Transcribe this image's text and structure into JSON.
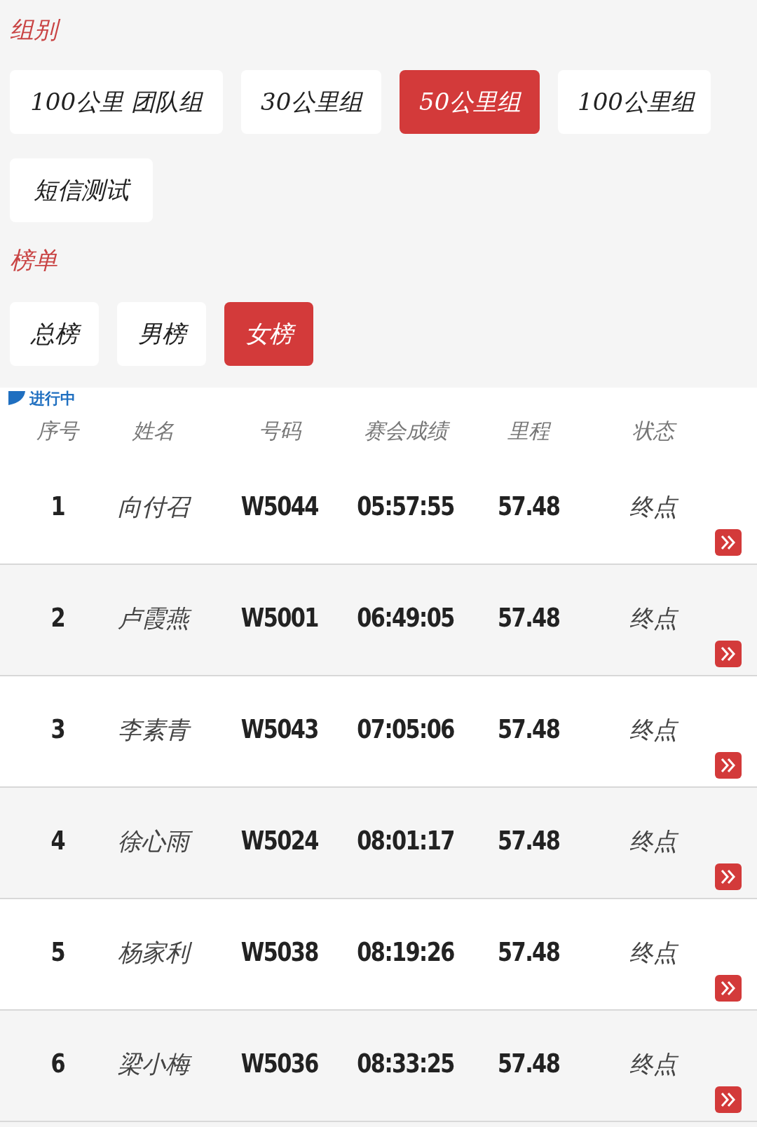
{
  "group_section": {
    "title": "组别",
    "options": [
      {
        "label": "100公里 团队组",
        "selected": false
      },
      {
        "label": "30公里组",
        "selected": false
      },
      {
        "label": "50公里组",
        "selected": true
      },
      {
        "label": "100公里组",
        "selected": false
      },
      {
        "label": "短信测试",
        "selected": false
      }
    ]
  },
  "ranking_section": {
    "title": "榜单",
    "tabs": [
      {
        "label": "总榜",
        "selected": false
      },
      {
        "label": "男榜",
        "selected": false
      },
      {
        "label": "女榜",
        "selected": true
      }
    ]
  },
  "table": {
    "status_badge": "进行中",
    "columns": [
      "序号",
      "姓名",
      "号码",
      "赛会成绩",
      "里程",
      "状态"
    ],
    "rows": [
      [
        "1",
        "向付召",
        "W5044",
        "05:57:55",
        "57.48",
        "终点"
      ],
      [
        "2",
        "卢霞燕",
        "W5001",
        "06:49:05",
        "57.48",
        "终点"
      ],
      [
        "3",
        "李素青",
        "W5043",
        "07:05:06",
        "57.48",
        "终点"
      ],
      [
        "4",
        "徐心雨",
        "W5024",
        "08:01:17",
        "57.48",
        "终点"
      ],
      [
        "5",
        "杨家利",
        "W5038",
        "08:19:26",
        "57.48",
        "终点"
      ],
      [
        "6",
        "梁小梅",
        "W5036",
        "08:33:25",
        "57.48",
        "终点"
      ]
    ]
  }
}
